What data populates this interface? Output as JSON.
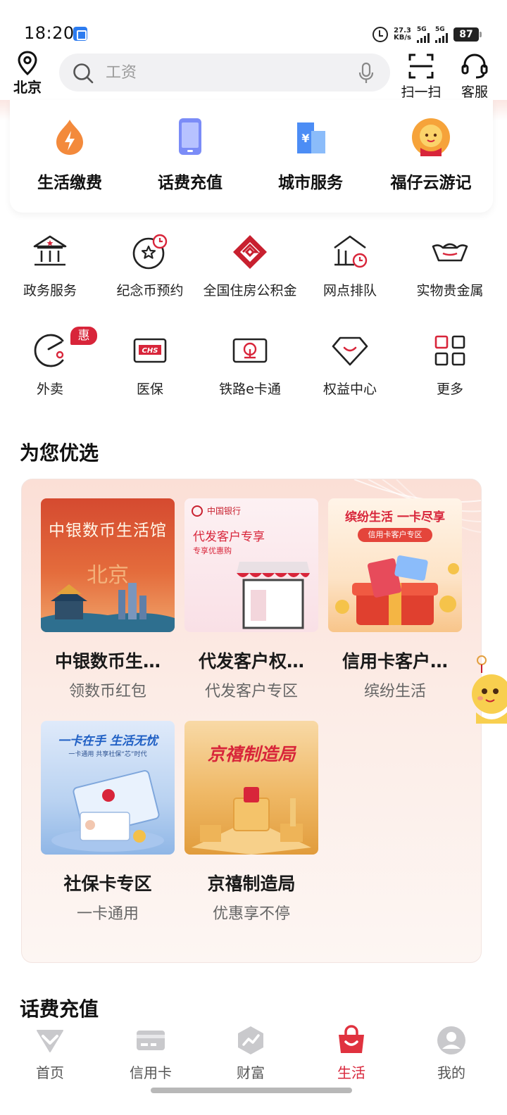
{
  "status_bar": {
    "time": "18:20",
    "net_speed_value": "27.3",
    "net_speed_unit": "KB/s",
    "sim1": "5G",
    "sim2": "5G",
    "battery": "87"
  },
  "header": {
    "location": "北京",
    "search_placeholder": "工资",
    "scan_label": "扫一扫",
    "service_label": "客服"
  },
  "top_services": [
    {
      "label": "生活缴费",
      "icon": "flame-icon"
    },
    {
      "label": "话费充值",
      "icon": "phone-icon"
    },
    {
      "label": "城市服务",
      "icon": "city-building-icon"
    },
    {
      "label": "福仔云游记",
      "icon": "mascot-icon"
    }
  ],
  "grid_services": [
    {
      "label": "政务服务",
      "icon": "government-building-icon"
    },
    {
      "label": "纪念币预约",
      "icon": "coin-star-clock-icon"
    },
    {
      "label": "全国住房公积金",
      "icon": "housing-fund-logo-icon"
    },
    {
      "label": "网点排队",
      "icon": "branch-queue-icon"
    },
    {
      "label": "实物贵金属",
      "icon": "gold-ingot-icon"
    },
    {
      "label": "外卖",
      "icon": "takeout-icon",
      "badge": "惠"
    },
    {
      "label": "医保",
      "icon": "chs-card-icon"
    },
    {
      "label": "铁路e卡通",
      "icon": "railway-card-icon"
    },
    {
      "label": "权益中心",
      "icon": "diamond-icon"
    },
    {
      "label": "更多",
      "icon": "more-grid-icon"
    }
  ],
  "foryou": {
    "title": "为您优选",
    "products": [
      {
        "title": "中银数币生…",
        "subtitle": "领数币红包",
        "thumb_text": "中银数币生活馆",
        "thumb_sub": "北京"
      },
      {
        "title": "代发客户权…",
        "subtitle": "代发客户专区",
        "thumb_text": "代发客户专享",
        "thumb_sub": "专享优惠购",
        "thumb_brand": "中国银行"
      },
      {
        "title": "信用卡客户…",
        "subtitle": "缤纷生活",
        "thumb_text": "缤纷生活 一卡尽享",
        "thumb_sub": "信用卡客户专区"
      },
      {
        "title": "社保卡专区",
        "subtitle": "一卡通用",
        "thumb_text": "一卡在手 生活无忧",
        "thumb_sub": "一卡通用 共享社保“芯”时代"
      },
      {
        "title": "京禧制造局",
        "subtitle": "优惠享不停",
        "thumb_text": "京禧制造局"
      }
    ]
  },
  "next_section": {
    "title": "话费充值"
  },
  "tabbar": [
    {
      "label": "首页",
      "icon": "home-icon",
      "active": false
    },
    {
      "label": "信用卡",
      "icon": "credit-card-icon",
      "active": false
    },
    {
      "label": "财富",
      "icon": "wealth-icon",
      "active": false
    },
    {
      "label": "生活",
      "icon": "shopping-bag-icon",
      "active": true
    },
    {
      "label": "我的",
      "icon": "profile-icon",
      "active": false
    }
  ],
  "colors": {
    "brand_red": "#d8253a",
    "search_bg": "#f1f1f3",
    "foryou_bg": "#fbdfd6"
  }
}
